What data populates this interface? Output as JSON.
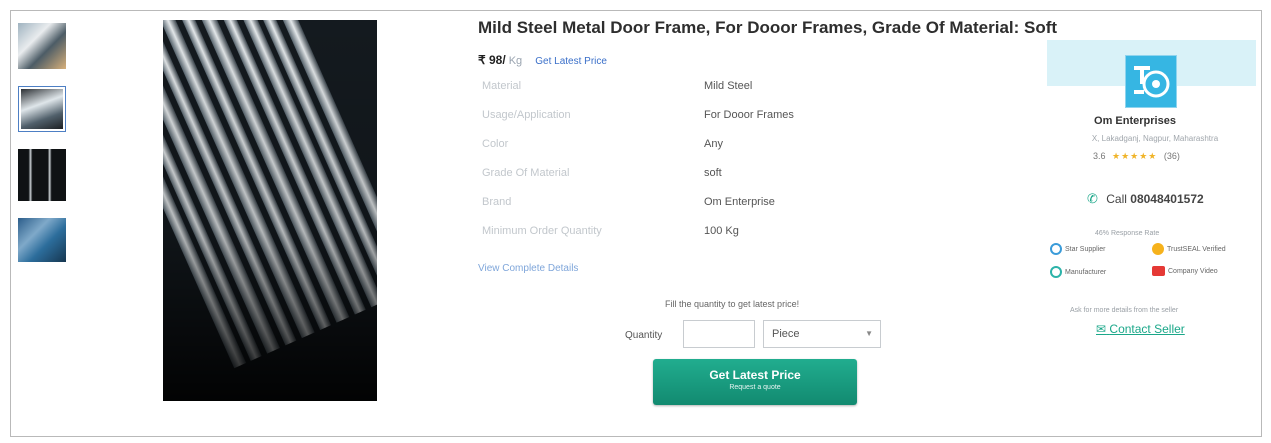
{
  "product": {
    "title": "Mild Steel Metal Door Frame, For Dooor Frames, Grade Of Material: Soft",
    "price": "₹ 98/",
    "price_unit": "Kg",
    "latest_price_link": "Get Latest Price",
    "specs": [
      {
        "key": "Material",
        "value": "Mild Steel"
      },
      {
        "key": "Usage/Application",
        "value": "For Dooor Frames"
      },
      {
        "key": "Color",
        "value": "Any"
      },
      {
        "key": "Grade Of Material",
        "value": "soft"
      },
      {
        "key": "Brand",
        "value": "Om Enterprise"
      },
      {
        "key": "Minimum Order Quantity",
        "value": "100 Kg"
      }
    ],
    "view_details": "View Complete Details"
  },
  "quote": {
    "hint": "Fill the quantity to get latest price!",
    "quantity_label": "Quantity",
    "quantity_value": "",
    "unit_selected": "Piece",
    "cta_label": "Get Latest Price",
    "cta_sub": "Request a quote"
  },
  "seller": {
    "name": "Om Enterprises",
    "location": "X, Lakadganj, Nagpur, Maharashtra",
    "rating": "3.6",
    "stars": "★★★★★",
    "reviews": "(36)",
    "call_label": "Call",
    "phone": "08048401572",
    "response_rate": "46% Response Rate",
    "badges": {
      "star_supplier": "Star Supplier",
      "trustseal": "TrustSEAL Verified",
      "manufacturer": "Manufacturer",
      "company_video": "Company Video"
    },
    "ask_hint": "Ask for more details from the seller",
    "contact_label": "Contact Seller"
  },
  "colors": {
    "accent": "#1aa789",
    "link": "#3a6fc9",
    "cta": "#128a70"
  }
}
